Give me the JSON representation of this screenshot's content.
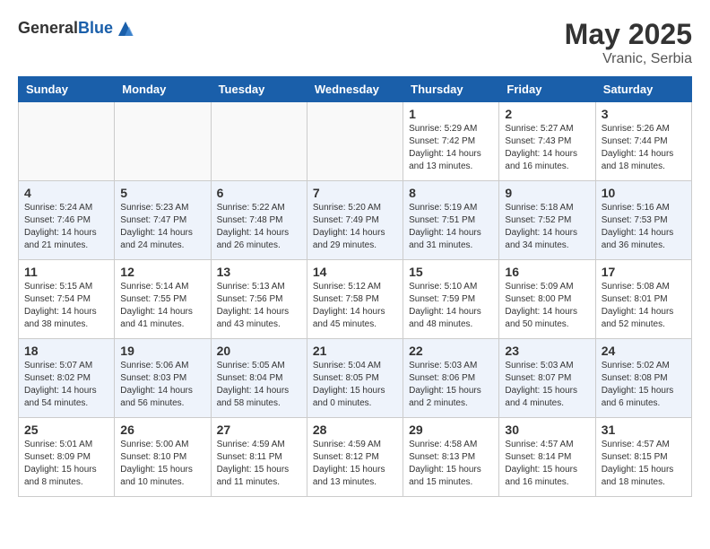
{
  "header": {
    "logo_general": "General",
    "logo_blue": "Blue",
    "month_year": "May 2025",
    "location": "Vranic, Serbia"
  },
  "days_of_week": [
    "Sunday",
    "Monday",
    "Tuesday",
    "Wednesday",
    "Thursday",
    "Friday",
    "Saturday"
  ],
  "weeks": [
    [
      {
        "day": "",
        "info": ""
      },
      {
        "day": "",
        "info": ""
      },
      {
        "day": "",
        "info": ""
      },
      {
        "day": "",
        "info": ""
      },
      {
        "day": "1",
        "info": "Sunrise: 5:29 AM\nSunset: 7:42 PM\nDaylight: 14 hours\nand 13 minutes."
      },
      {
        "day": "2",
        "info": "Sunrise: 5:27 AM\nSunset: 7:43 PM\nDaylight: 14 hours\nand 16 minutes."
      },
      {
        "day": "3",
        "info": "Sunrise: 5:26 AM\nSunset: 7:44 PM\nDaylight: 14 hours\nand 18 minutes."
      }
    ],
    [
      {
        "day": "4",
        "info": "Sunrise: 5:24 AM\nSunset: 7:46 PM\nDaylight: 14 hours\nand 21 minutes."
      },
      {
        "day": "5",
        "info": "Sunrise: 5:23 AM\nSunset: 7:47 PM\nDaylight: 14 hours\nand 24 minutes."
      },
      {
        "day": "6",
        "info": "Sunrise: 5:22 AM\nSunset: 7:48 PM\nDaylight: 14 hours\nand 26 minutes."
      },
      {
        "day": "7",
        "info": "Sunrise: 5:20 AM\nSunset: 7:49 PM\nDaylight: 14 hours\nand 29 minutes."
      },
      {
        "day": "8",
        "info": "Sunrise: 5:19 AM\nSunset: 7:51 PM\nDaylight: 14 hours\nand 31 minutes."
      },
      {
        "day": "9",
        "info": "Sunrise: 5:18 AM\nSunset: 7:52 PM\nDaylight: 14 hours\nand 34 minutes."
      },
      {
        "day": "10",
        "info": "Sunrise: 5:16 AM\nSunset: 7:53 PM\nDaylight: 14 hours\nand 36 minutes."
      }
    ],
    [
      {
        "day": "11",
        "info": "Sunrise: 5:15 AM\nSunset: 7:54 PM\nDaylight: 14 hours\nand 38 minutes."
      },
      {
        "day": "12",
        "info": "Sunrise: 5:14 AM\nSunset: 7:55 PM\nDaylight: 14 hours\nand 41 minutes."
      },
      {
        "day": "13",
        "info": "Sunrise: 5:13 AM\nSunset: 7:56 PM\nDaylight: 14 hours\nand 43 minutes."
      },
      {
        "day": "14",
        "info": "Sunrise: 5:12 AM\nSunset: 7:58 PM\nDaylight: 14 hours\nand 45 minutes."
      },
      {
        "day": "15",
        "info": "Sunrise: 5:10 AM\nSunset: 7:59 PM\nDaylight: 14 hours\nand 48 minutes."
      },
      {
        "day": "16",
        "info": "Sunrise: 5:09 AM\nSunset: 8:00 PM\nDaylight: 14 hours\nand 50 minutes."
      },
      {
        "day": "17",
        "info": "Sunrise: 5:08 AM\nSunset: 8:01 PM\nDaylight: 14 hours\nand 52 minutes."
      }
    ],
    [
      {
        "day": "18",
        "info": "Sunrise: 5:07 AM\nSunset: 8:02 PM\nDaylight: 14 hours\nand 54 minutes."
      },
      {
        "day": "19",
        "info": "Sunrise: 5:06 AM\nSunset: 8:03 PM\nDaylight: 14 hours\nand 56 minutes."
      },
      {
        "day": "20",
        "info": "Sunrise: 5:05 AM\nSunset: 8:04 PM\nDaylight: 14 hours\nand 58 minutes."
      },
      {
        "day": "21",
        "info": "Sunrise: 5:04 AM\nSunset: 8:05 PM\nDaylight: 15 hours\nand 0 minutes."
      },
      {
        "day": "22",
        "info": "Sunrise: 5:03 AM\nSunset: 8:06 PM\nDaylight: 15 hours\nand 2 minutes."
      },
      {
        "day": "23",
        "info": "Sunrise: 5:03 AM\nSunset: 8:07 PM\nDaylight: 15 hours\nand 4 minutes."
      },
      {
        "day": "24",
        "info": "Sunrise: 5:02 AM\nSunset: 8:08 PM\nDaylight: 15 hours\nand 6 minutes."
      }
    ],
    [
      {
        "day": "25",
        "info": "Sunrise: 5:01 AM\nSunset: 8:09 PM\nDaylight: 15 hours\nand 8 minutes."
      },
      {
        "day": "26",
        "info": "Sunrise: 5:00 AM\nSunset: 8:10 PM\nDaylight: 15 hours\nand 10 minutes."
      },
      {
        "day": "27",
        "info": "Sunrise: 4:59 AM\nSunset: 8:11 PM\nDaylight: 15 hours\nand 11 minutes."
      },
      {
        "day": "28",
        "info": "Sunrise: 4:59 AM\nSunset: 8:12 PM\nDaylight: 15 hours\nand 13 minutes."
      },
      {
        "day": "29",
        "info": "Sunrise: 4:58 AM\nSunset: 8:13 PM\nDaylight: 15 hours\nand 15 minutes."
      },
      {
        "day": "30",
        "info": "Sunrise: 4:57 AM\nSunset: 8:14 PM\nDaylight: 15 hours\nand 16 minutes."
      },
      {
        "day": "31",
        "info": "Sunrise: 4:57 AM\nSunset: 8:15 PM\nDaylight: 15 hours\nand 18 minutes."
      }
    ]
  ]
}
